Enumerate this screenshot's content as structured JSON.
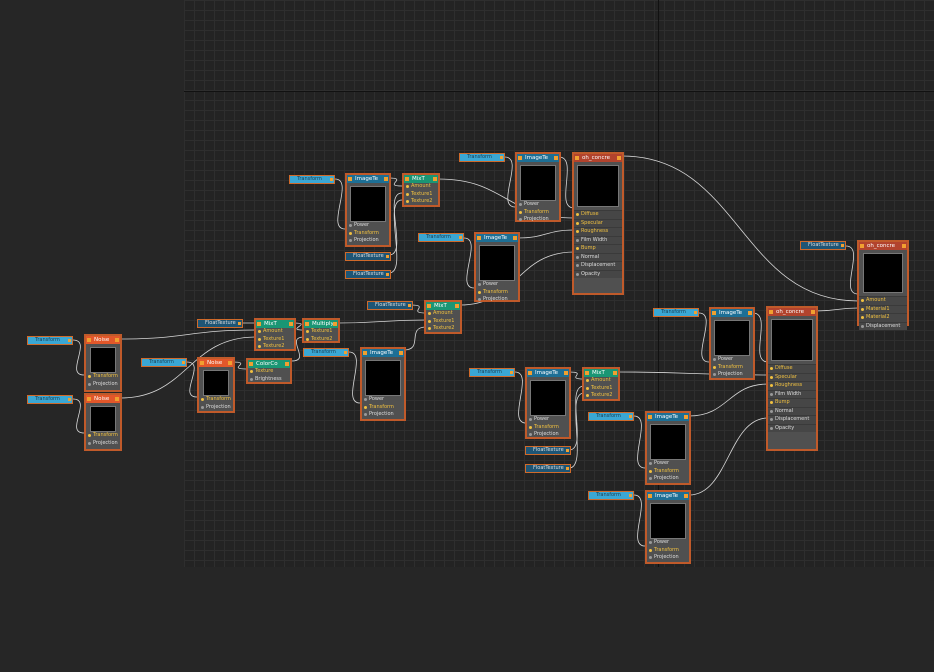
{
  "nodes": {
    "transform_label": "Transform",
    "floattexture_label": "FloatTexture",
    "imagetexture_title": "ImageTe",
    "noise_title": "Noise",
    "mix_title": "MixT",
    "multiply_title": "Multiply",
    "colorcorrect_title": "ColorCo",
    "material_title": "oh_concre",
    "mixmaterial_title": "oh_concre",
    "rows": {
      "power": "Power",
      "transform": "Transform",
      "projection": "Projection",
      "amount": "Amount",
      "texture1": "Texture1",
      "texture2": "Texture2",
      "texture": "Texture",
      "brightness": "Brightness",
      "material1": "Material1",
      "material2": "Material2",
      "displacement": "Displacement"
    },
    "material_rows": [
      "Diffuse",
      "Specular",
      "Roughness",
      "Film Width",
      "Bump",
      "Normal",
      "Displacement",
      "Opacity"
    ]
  },
  "colors": {
    "background": "#262626",
    "grid": "#232323",
    "wire": "#d8d8d8",
    "node_border": "#c05a2a",
    "image_header": "#1d6f95",
    "noise_header": "#e2572a",
    "mix_header": "#1a9674",
    "material_header": "#b2432d",
    "transform_chip": "#3aa7d4",
    "float_chip": "#1e5575"
  }
}
